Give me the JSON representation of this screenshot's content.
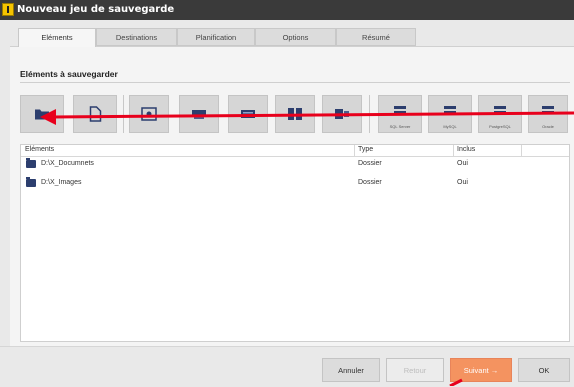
{
  "window": {
    "title": "Nouveau jeu de sauvegarde"
  },
  "tabs": [
    {
      "label": "Eléments",
      "active": true
    },
    {
      "label": "Destinations"
    },
    {
      "label": "Planification"
    },
    {
      "label": "Options"
    },
    {
      "label": "Résumé"
    }
  ],
  "section": {
    "title": "Eléments à sauvegarder"
  },
  "toolbar": {
    "buttons": [
      {
        "icon": "folder-icon"
      },
      {
        "icon": "file-icon"
      },
      {
        "icon": "disk-image-icon"
      },
      {
        "icon": "scanner-icon"
      },
      {
        "icon": "drive-icon"
      },
      {
        "icon": "server-icon"
      },
      {
        "icon": "exchange-icon"
      },
      {
        "icon": "database-icon",
        "label": "SQL Server"
      },
      {
        "icon": "database-icon",
        "label": "MySQL"
      },
      {
        "icon": "database-icon",
        "label": "PostgreSQL"
      },
      {
        "icon": "database-icon",
        "label": "Oracle"
      }
    ]
  },
  "list": {
    "columns": [
      "Eléments",
      "Type",
      "Inclus"
    ],
    "rows": [
      {
        "element": "D:\\X_Documnets",
        "type": "Dossier",
        "included": "Oui"
      },
      {
        "element": "D:\\X_Images",
        "type": "Dossier",
        "included": "Oui"
      }
    ]
  },
  "footer": {
    "cancel": "Annuler",
    "back": "Retour",
    "next": "Suivant →",
    "ok": "OK"
  },
  "colors": {
    "accent": "#f49360",
    "annotation": "#e8001c",
    "folder": "#2c3e6e"
  }
}
